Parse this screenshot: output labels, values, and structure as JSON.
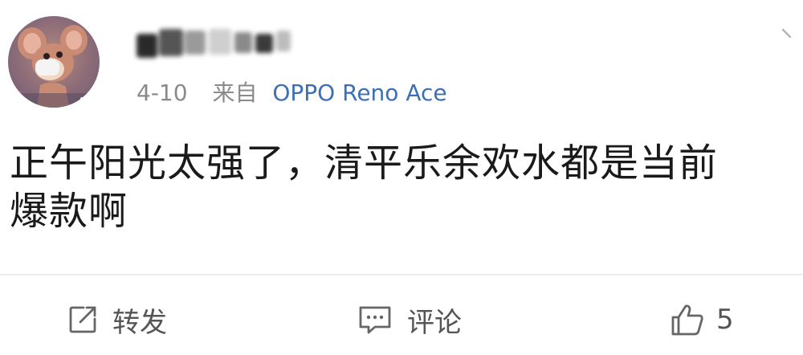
{
  "post": {
    "meta": {
      "date": "4-10",
      "source_label": "来自",
      "device": "OPPO Reno Ace"
    },
    "content_lines": [
      "正午阳光太强了，清平乐余欢水都是当前",
      "爆款啊"
    ],
    "actions": {
      "forward_label": "转发",
      "comment_label": "评论",
      "like_count": "5"
    },
    "icons": {
      "avatar": "cartoon-mouse-avatar",
      "badge": "verified-badge-icon",
      "chevron": "chevron-down-icon",
      "forward": "share-icon",
      "comment": "comment-icon",
      "like": "thumbs-up-icon"
    },
    "colors": {
      "device_link": "#3d6fb5",
      "badge": "#f5a623",
      "meta_text": "#8a8a8a"
    }
  }
}
